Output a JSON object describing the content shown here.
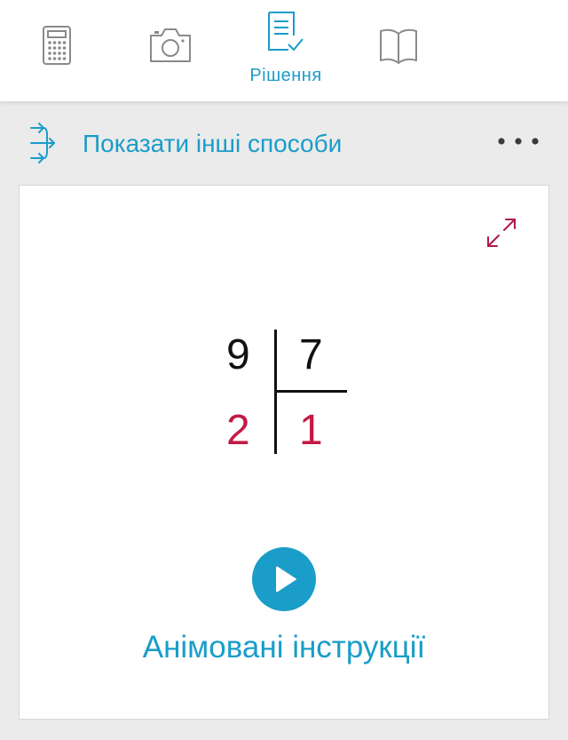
{
  "tabs": {
    "calculator": {
      "icon": "calculator-icon"
    },
    "camera": {
      "icon": "camera-icon"
    },
    "solution": {
      "icon": "solution-icon",
      "label": "Рішення",
      "active": true
    },
    "book": {
      "icon": "book-icon"
    }
  },
  "methods_bar": {
    "label": "Показати інші способи",
    "icon": "branch-arrows-icon",
    "more_icon": "more-dots-icon"
  },
  "card": {
    "expand_icon": "expand-icon",
    "division": {
      "dividend": "9",
      "divisor": "7",
      "remainder": "2",
      "quotient": "1"
    },
    "play_icon": "play-icon",
    "play_label": "Анімовані інструкції"
  },
  "colors": {
    "accent": "#1a9dc9",
    "result_red": "#c41a44"
  }
}
